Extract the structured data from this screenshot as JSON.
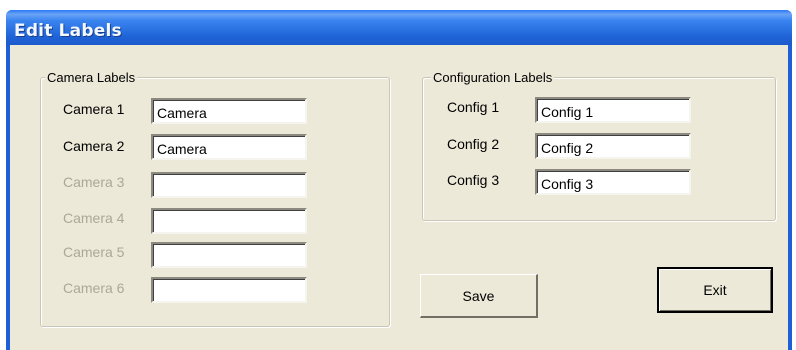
{
  "window": {
    "title": "Edit Labels"
  },
  "camera_group": {
    "legend": "Camera Labels",
    "rows": [
      {
        "label": "Camera 1",
        "value": "Camera",
        "enabled": true
      },
      {
        "label": "Camera 2",
        "value": "Camera",
        "enabled": true
      },
      {
        "label": "Camera 3",
        "value": "",
        "enabled": false
      },
      {
        "label": "Camera 4",
        "value": "",
        "enabled": false
      },
      {
        "label": "Camera 5",
        "value": "",
        "enabled": false
      },
      {
        "label": "Camera 6",
        "value": "",
        "enabled": false
      }
    ]
  },
  "config_group": {
    "legend": "Configuration Labels",
    "rows": [
      {
        "label": "Config 1",
        "value": "Config 1",
        "enabled": true
      },
      {
        "label": "Config 2",
        "value": "Config 2",
        "enabled": true
      },
      {
        "label": "Config 3",
        "value": "Config 3",
        "enabled": true
      }
    ]
  },
  "buttons": {
    "save_label": "Save",
    "exit_label": "Exit"
  }
}
